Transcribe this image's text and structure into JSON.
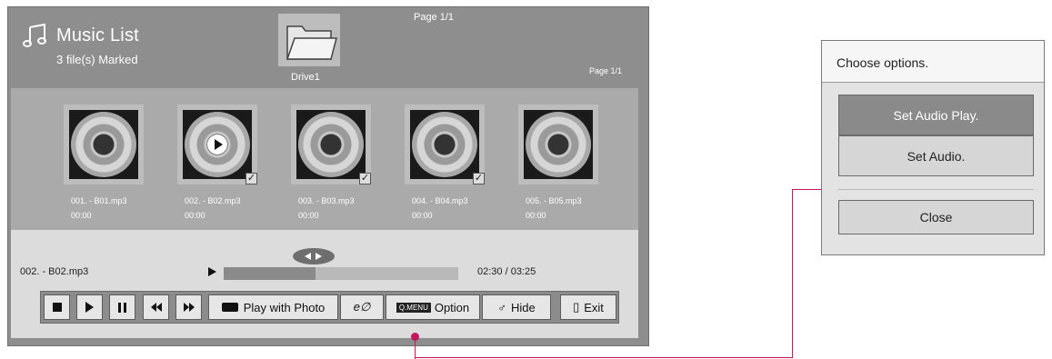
{
  "header": {
    "title": "Music List",
    "subtitle": "3 file(s) Marked",
    "drive_label": "Drive1",
    "page_top": "Page 1/1",
    "page_right": "Page 1/1"
  },
  "files": [
    {
      "name": "001. - B01.mp3",
      "time": "00:00",
      "marked": false,
      "playing": false
    },
    {
      "name": "002. - B02.mp3",
      "time": "00:00",
      "marked": true,
      "playing": true
    },
    {
      "name": "003. - B03.mp3",
      "time": "00:00",
      "marked": true,
      "playing": false
    },
    {
      "name": "004. - B04.mp3",
      "time": "00:00",
      "marked": true,
      "playing": false
    },
    {
      "name": "005. - B05.mp3",
      "time": "00:00",
      "marked": false,
      "playing": false
    }
  ],
  "player": {
    "current_file": "002. - B02.mp3",
    "time": "02:30 / 03:25",
    "progress_percent": 39
  },
  "controls": {
    "play_with_photo": "Play with Photo",
    "energy_icon": "e∅",
    "qmenu_tag": "Q.MENU",
    "option": "Option",
    "hide": "Hide",
    "exit": "Exit"
  },
  "options_panel": {
    "title": "Choose options.",
    "items": [
      "Set Audio Play.",
      "Set Audio."
    ],
    "close": "Close"
  },
  "colors": {
    "callout_line": "#c2185b",
    "selected_option": "#8a8a8a"
  }
}
